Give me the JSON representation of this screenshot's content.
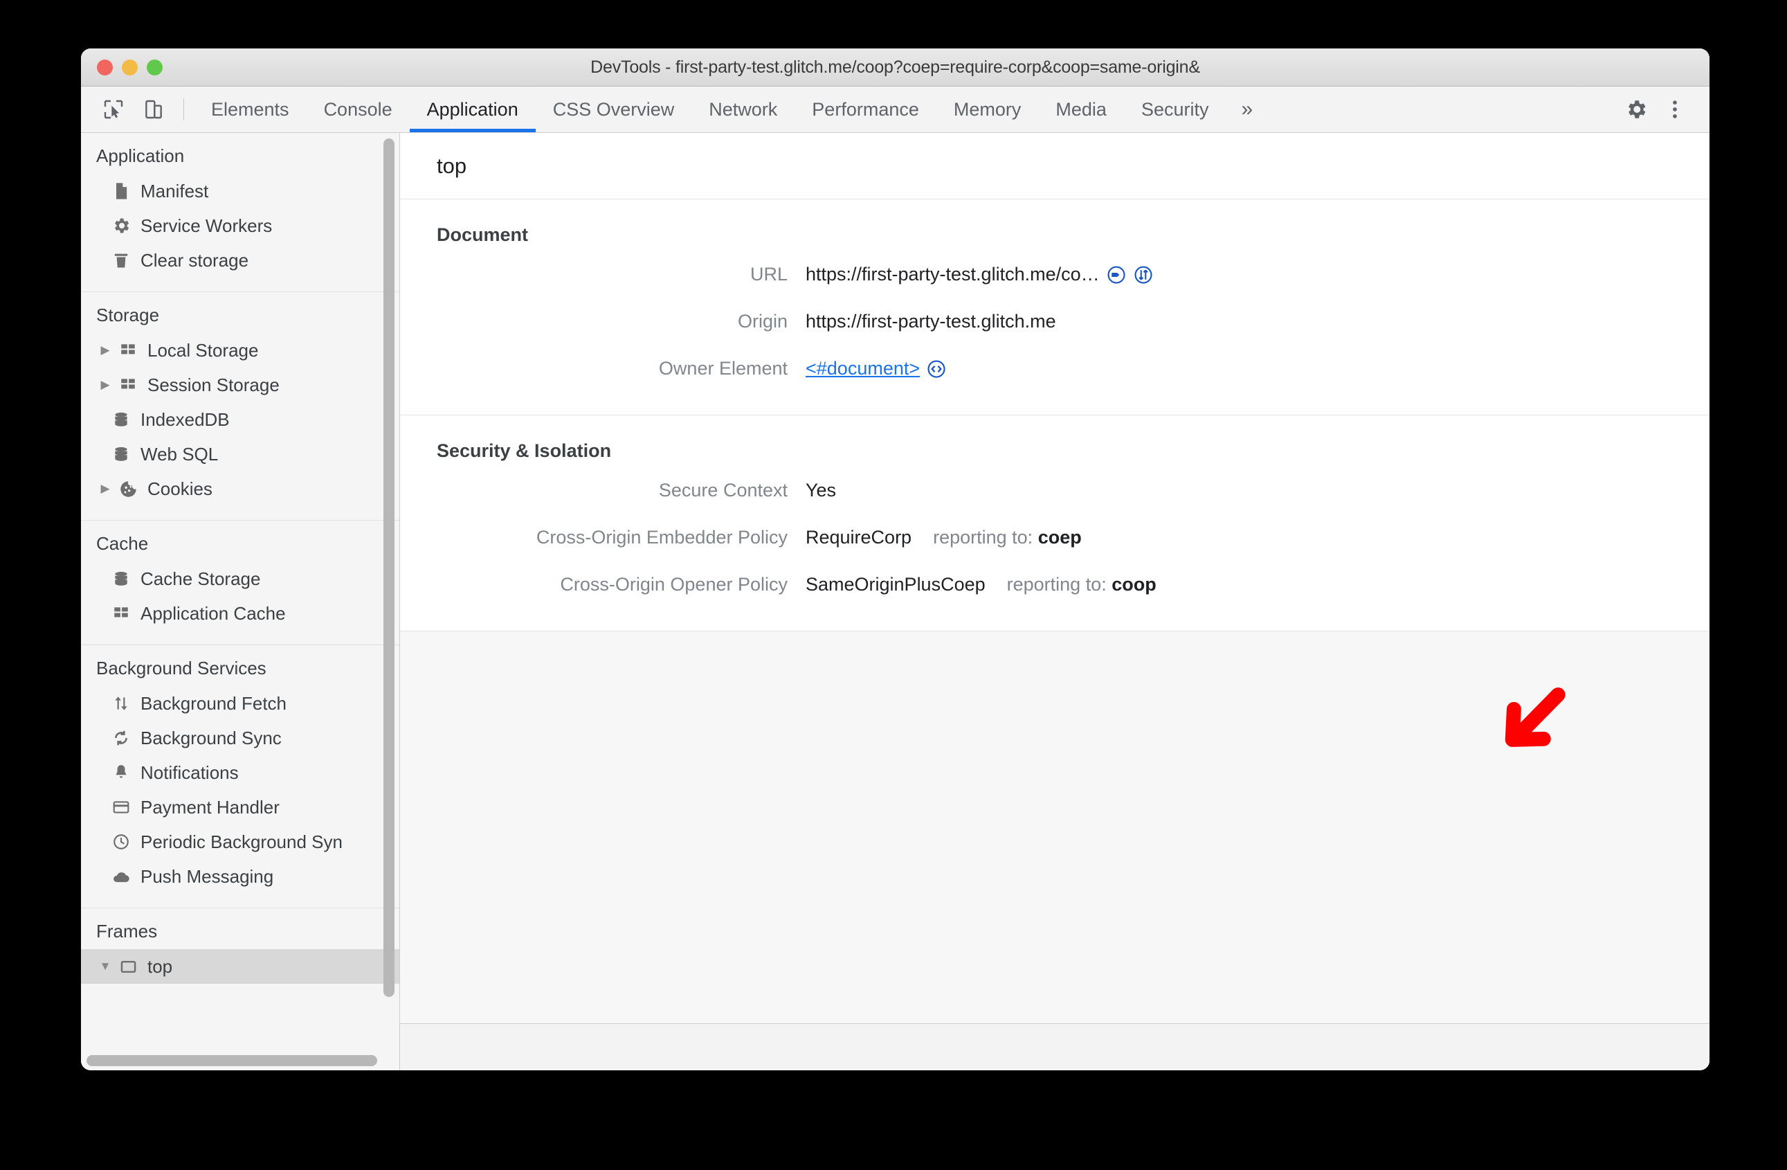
{
  "window": {
    "title": "DevTools - first-party-test.glitch.me/coop?coep=require-corp&coop=same-origin&",
    "traffic_lights": [
      "close",
      "minimize",
      "zoom"
    ]
  },
  "toolbar": {
    "inspect_icon": "inspect-cursor-icon",
    "device_icon": "device-toolbar-icon",
    "tabs": [
      {
        "label": "Elements",
        "active": false
      },
      {
        "label": "Console",
        "active": false
      },
      {
        "label": "Application",
        "active": true
      },
      {
        "label": "CSS Overview",
        "active": false
      },
      {
        "label": "Network",
        "active": false
      },
      {
        "label": "Performance",
        "active": false
      },
      {
        "label": "Memory",
        "active": false
      },
      {
        "label": "Media",
        "active": false
      },
      {
        "label": "Security",
        "active": false
      }
    ],
    "more_tabs_label": "»",
    "settings_icon": "gear-icon",
    "menu_icon": "kebab-menu-icon",
    "active_tab_color": "#1a73e8"
  },
  "sidebar": {
    "sections": [
      {
        "title": "Application",
        "items": [
          {
            "label": "Manifest",
            "icon": "manifest-file-icon",
            "twisty": false,
            "selected": false
          },
          {
            "label": "Service Workers",
            "icon": "gear-icon",
            "twisty": false,
            "selected": false
          },
          {
            "label": "Clear storage",
            "icon": "trash-icon",
            "twisty": false,
            "selected": false
          }
        ]
      },
      {
        "title": "Storage",
        "items": [
          {
            "label": "Local Storage",
            "icon": "table-icon",
            "twisty": "collapsed",
            "selected": false
          },
          {
            "label": "Session Storage",
            "icon": "table-icon",
            "twisty": "collapsed",
            "selected": false
          },
          {
            "label": "IndexedDB",
            "icon": "database-icon",
            "twisty": false,
            "selected": false
          },
          {
            "label": "Web SQL",
            "icon": "database-icon",
            "twisty": false,
            "selected": false
          },
          {
            "label": "Cookies",
            "icon": "cookie-icon",
            "twisty": "collapsed",
            "selected": false
          }
        ]
      },
      {
        "title": "Cache",
        "items": [
          {
            "label": "Cache Storage",
            "icon": "database-icon",
            "twisty": false,
            "selected": false
          },
          {
            "label": "Application Cache",
            "icon": "table-icon",
            "twisty": false,
            "selected": false
          }
        ]
      },
      {
        "title": "Background Services",
        "items": [
          {
            "label": "Background Fetch",
            "icon": "arrows-updown-icon",
            "twisty": false,
            "selected": false
          },
          {
            "label": "Background Sync",
            "icon": "sync-icon",
            "twisty": false,
            "selected": false
          },
          {
            "label": "Notifications",
            "icon": "bell-icon",
            "twisty": false,
            "selected": false
          },
          {
            "label": "Payment Handler",
            "icon": "credit-card-icon",
            "twisty": false,
            "selected": false
          },
          {
            "label": "Periodic Background Syn",
            "icon": "clock-icon",
            "twisty": false,
            "selected": false
          },
          {
            "label": "Push Messaging",
            "icon": "cloud-icon",
            "twisty": false,
            "selected": false
          }
        ]
      },
      {
        "title": "Frames",
        "items": [
          {
            "label": "top",
            "icon": "frame-icon",
            "twisty": "expanded",
            "selected": true
          }
        ]
      }
    ]
  },
  "main": {
    "frame_title": "top",
    "sections": [
      {
        "heading": "Document",
        "rows": [
          {
            "label": "URL",
            "value": "https://first-party-test.glitch.me/co…",
            "icons": [
              "reveal-in-elements-icon",
              "reveal-in-network-icon"
            ],
            "link": false
          },
          {
            "label": "Origin",
            "value": "https://first-party-test.glitch.me",
            "icons": [],
            "link": false
          },
          {
            "label": "Owner Element",
            "value": "<#document>",
            "icons": [
              "reveal-in-sources-icon"
            ],
            "link": true
          }
        ]
      },
      {
        "heading": "Security & Isolation",
        "rows": [
          {
            "label": "Secure Context",
            "value": "Yes",
            "icons": [],
            "link": false
          },
          {
            "label": "Cross-Origin Embedder Policy",
            "value": "RequireCorp",
            "reporting_prefix": "reporting to:",
            "reporting_endpoint": "coep",
            "icons": [],
            "link": false
          },
          {
            "label": "Cross-Origin Opener Policy",
            "value": "SameOriginPlusCoep",
            "reporting_prefix": "reporting to:",
            "reporting_endpoint": "coop",
            "icons": [],
            "link": false
          }
        ]
      }
    ]
  },
  "annotation": {
    "arrow_color": "#ff0000",
    "arrow_direction": "down-left",
    "points_at": "coep"
  }
}
